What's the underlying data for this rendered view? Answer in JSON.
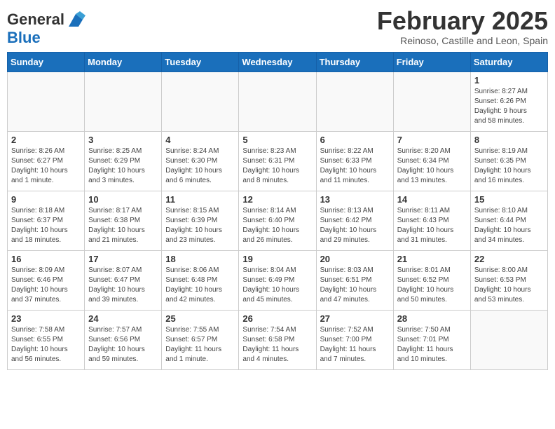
{
  "logo": {
    "line1": "General",
    "line2": "Blue"
  },
  "title": "February 2025",
  "subtitle": "Reinoso, Castille and Leon, Spain",
  "days_of_week": [
    "Sunday",
    "Monday",
    "Tuesday",
    "Wednesday",
    "Thursday",
    "Friday",
    "Saturday"
  ],
  "weeks": [
    [
      {
        "day": "",
        "info": ""
      },
      {
        "day": "",
        "info": ""
      },
      {
        "day": "",
        "info": ""
      },
      {
        "day": "",
        "info": ""
      },
      {
        "day": "",
        "info": ""
      },
      {
        "day": "",
        "info": ""
      },
      {
        "day": "1",
        "info": "Sunrise: 8:27 AM\nSunset: 6:26 PM\nDaylight: 9 hours\nand 58 minutes."
      }
    ],
    [
      {
        "day": "2",
        "info": "Sunrise: 8:26 AM\nSunset: 6:27 PM\nDaylight: 10 hours\nand 1 minute."
      },
      {
        "day": "3",
        "info": "Sunrise: 8:25 AM\nSunset: 6:29 PM\nDaylight: 10 hours\nand 3 minutes."
      },
      {
        "day": "4",
        "info": "Sunrise: 8:24 AM\nSunset: 6:30 PM\nDaylight: 10 hours\nand 6 minutes."
      },
      {
        "day": "5",
        "info": "Sunrise: 8:23 AM\nSunset: 6:31 PM\nDaylight: 10 hours\nand 8 minutes."
      },
      {
        "day": "6",
        "info": "Sunrise: 8:22 AM\nSunset: 6:33 PM\nDaylight: 10 hours\nand 11 minutes."
      },
      {
        "day": "7",
        "info": "Sunrise: 8:20 AM\nSunset: 6:34 PM\nDaylight: 10 hours\nand 13 minutes."
      },
      {
        "day": "8",
        "info": "Sunrise: 8:19 AM\nSunset: 6:35 PM\nDaylight: 10 hours\nand 16 minutes."
      }
    ],
    [
      {
        "day": "9",
        "info": "Sunrise: 8:18 AM\nSunset: 6:37 PM\nDaylight: 10 hours\nand 18 minutes."
      },
      {
        "day": "10",
        "info": "Sunrise: 8:17 AM\nSunset: 6:38 PM\nDaylight: 10 hours\nand 21 minutes."
      },
      {
        "day": "11",
        "info": "Sunrise: 8:15 AM\nSunset: 6:39 PM\nDaylight: 10 hours\nand 23 minutes."
      },
      {
        "day": "12",
        "info": "Sunrise: 8:14 AM\nSunset: 6:40 PM\nDaylight: 10 hours\nand 26 minutes."
      },
      {
        "day": "13",
        "info": "Sunrise: 8:13 AM\nSunset: 6:42 PM\nDaylight: 10 hours\nand 29 minutes."
      },
      {
        "day": "14",
        "info": "Sunrise: 8:11 AM\nSunset: 6:43 PM\nDaylight: 10 hours\nand 31 minutes."
      },
      {
        "day": "15",
        "info": "Sunrise: 8:10 AM\nSunset: 6:44 PM\nDaylight: 10 hours\nand 34 minutes."
      }
    ],
    [
      {
        "day": "16",
        "info": "Sunrise: 8:09 AM\nSunset: 6:46 PM\nDaylight: 10 hours\nand 37 minutes."
      },
      {
        "day": "17",
        "info": "Sunrise: 8:07 AM\nSunset: 6:47 PM\nDaylight: 10 hours\nand 39 minutes."
      },
      {
        "day": "18",
        "info": "Sunrise: 8:06 AM\nSunset: 6:48 PM\nDaylight: 10 hours\nand 42 minutes."
      },
      {
        "day": "19",
        "info": "Sunrise: 8:04 AM\nSunset: 6:49 PM\nDaylight: 10 hours\nand 45 minutes."
      },
      {
        "day": "20",
        "info": "Sunrise: 8:03 AM\nSunset: 6:51 PM\nDaylight: 10 hours\nand 47 minutes."
      },
      {
        "day": "21",
        "info": "Sunrise: 8:01 AM\nSunset: 6:52 PM\nDaylight: 10 hours\nand 50 minutes."
      },
      {
        "day": "22",
        "info": "Sunrise: 8:00 AM\nSunset: 6:53 PM\nDaylight: 10 hours\nand 53 minutes."
      }
    ],
    [
      {
        "day": "23",
        "info": "Sunrise: 7:58 AM\nSunset: 6:55 PM\nDaylight: 10 hours\nand 56 minutes."
      },
      {
        "day": "24",
        "info": "Sunrise: 7:57 AM\nSunset: 6:56 PM\nDaylight: 10 hours\nand 59 minutes."
      },
      {
        "day": "25",
        "info": "Sunrise: 7:55 AM\nSunset: 6:57 PM\nDaylight: 11 hours\nand 1 minute."
      },
      {
        "day": "26",
        "info": "Sunrise: 7:54 AM\nSunset: 6:58 PM\nDaylight: 11 hours\nand 4 minutes."
      },
      {
        "day": "27",
        "info": "Sunrise: 7:52 AM\nSunset: 7:00 PM\nDaylight: 11 hours\nand 7 minutes."
      },
      {
        "day": "28",
        "info": "Sunrise: 7:50 AM\nSunset: 7:01 PM\nDaylight: 11 hours\nand 10 minutes."
      },
      {
        "day": "",
        "info": ""
      }
    ]
  ]
}
